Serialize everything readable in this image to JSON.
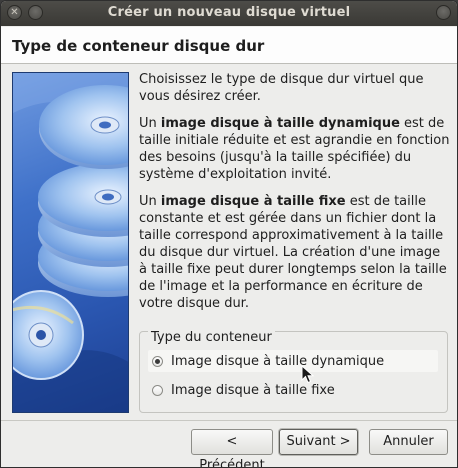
{
  "window": {
    "title": "Créer un nouveau disque virtuel"
  },
  "header": {
    "title": "Type de conteneur disque dur"
  },
  "content": {
    "intro": "Choisissez le type de disque dur virtuel que vous désirez créer.",
    "dynamic_prefix": "Un ",
    "dynamic_bold": "image disque à taille dynamique",
    "dynamic_rest": " est de taille initiale réduite et est agrandie en fonction des besoins (jusqu'à la taille spécifiée) du système d'exploitation invité.",
    "fixed_prefix": "Un ",
    "fixed_bold": "image disque à taille fixe",
    "fixed_rest": " est de taille constante et est gérée dans un fichier dont la taille correspond approximativement à la taille du disque dur virtuel. La création d'une image à taille fixe peut durer longtemps selon la taille de l'image et la performance en écriture de votre disque dur."
  },
  "container_group": {
    "legend": "Type du conteneur",
    "options": [
      {
        "label": "Image disque à taille dynamique",
        "selected": true
      },
      {
        "label": "Image disque à taille fixe",
        "selected": false
      }
    ]
  },
  "buttons": {
    "previous": "< Précédent",
    "next": "Suivant >",
    "cancel": "Annuler"
  },
  "colors": {
    "sidebar_blue": "#3f71c9",
    "titlebar": "#3a3935"
  }
}
